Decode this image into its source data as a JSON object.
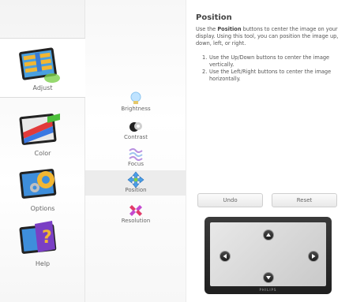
{
  "nav": {
    "items": [
      {
        "label": "Adjust",
        "active": true
      },
      {
        "label": "Color",
        "active": false
      },
      {
        "label": "Options",
        "active": false
      },
      {
        "label": "Help",
        "active": false
      }
    ]
  },
  "subnav": {
    "items": [
      {
        "label": "Brightness",
        "active": false
      },
      {
        "label": "Contrast",
        "active": false
      },
      {
        "label": "Focus",
        "active": false
      },
      {
        "label": "Position",
        "active": true
      },
      {
        "label": "Resolution",
        "active": false
      }
    ]
  },
  "content": {
    "title": "Position",
    "desc_before": "Use the ",
    "desc_bold": "Position",
    "desc_after": " buttons to center the image on your display. Using this tool, you can position the image up, down, left, or right.",
    "steps": [
      {
        "num": "1.",
        "text": "Use the Up/Down buttons to center the image vertically."
      },
      {
        "num": "2.",
        "text": "Use the Left/Right buttons to center the image horizontally."
      }
    ],
    "undo_label": "Undo",
    "reset_label": "Reset",
    "monitor_brand": "PHILIPS"
  },
  "colors": {
    "accent_blue": "#2a7fd0",
    "nav_active_bg": "#ffffff",
    "sub_active_bg": "#ececec"
  },
  "icons": {
    "adjust": "adjust-monitor-icon",
    "color": "color-palette-icon",
    "options": "gear-options-icon",
    "help": "help-question-icon",
    "brightness": "lightbulb-icon",
    "contrast": "contrast-icon",
    "focus": "focus-waves-icon",
    "position": "move-arrows-icon",
    "resolution": "resolution-icon"
  }
}
